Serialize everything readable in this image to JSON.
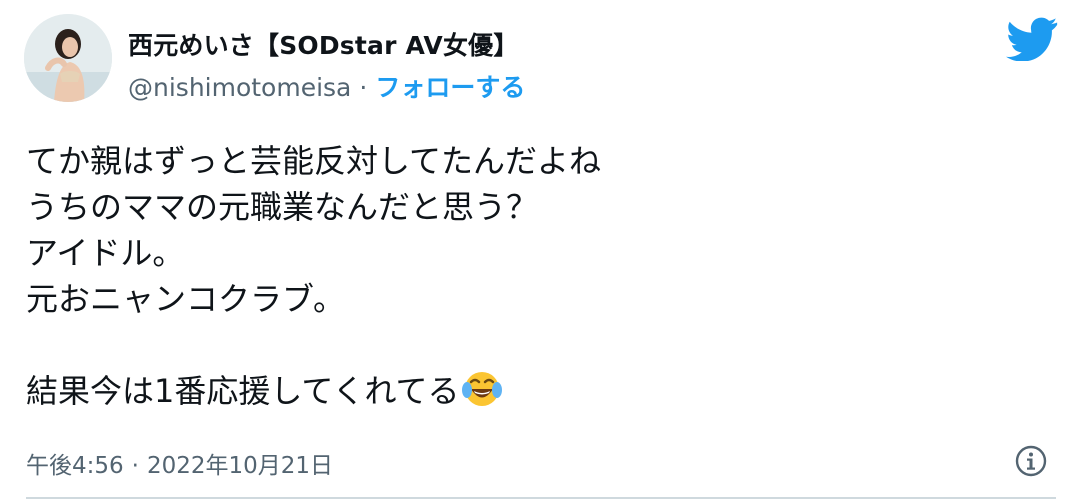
{
  "author": {
    "display_name": "西元めいさ【SODstar AV女優】",
    "handle": "@nishimotomeisa",
    "separator": "·",
    "follow_label": "フォローする"
  },
  "tweet": {
    "lines": [
      "てか親はずっと芸能反対してたんだよね",
      "うちのママの元職業なんだと思う？",
      "アイドル。",
      "元おニャンコクラブ。",
      "",
      "結果今は1番応援してくれてる"
    ],
    "emoji": "face-with-tears-of-joy"
  },
  "meta": {
    "time": "午後4:56",
    "separator": "·",
    "date": "2022年10月21日"
  },
  "icons": {
    "brand": "twitter-bird-icon",
    "info": "info-icon"
  },
  "colors": {
    "accent": "#1d9bf0",
    "text": "#0f1419",
    "secondary": "#536471",
    "divider": "#cfd9de"
  }
}
